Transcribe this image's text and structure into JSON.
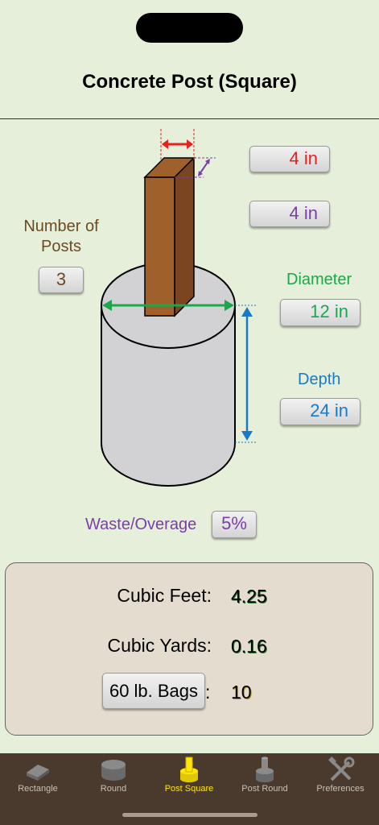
{
  "title": "Concrete Post (Square)",
  "inputs": {
    "post_width": "4 in",
    "post_depth": "4 in",
    "num_posts_label": "Number of Posts",
    "num_posts": "3",
    "diameter_label": "Diameter",
    "diameter": "12 in",
    "depth_label": "Depth",
    "depth": "24 in",
    "waste_label": "Waste/Overage",
    "waste": "5%"
  },
  "results": {
    "cubic_feet_label": "Cubic Feet:",
    "cubic_feet": "4.25",
    "cubic_yards_label": "Cubic Yards:",
    "cubic_yards": "0.16",
    "bags_button": "60 lb. Bags",
    "bags_colon": ":",
    "bags": "10"
  },
  "tabs": [
    {
      "label": "Rectangle",
      "icon": "rectangle-slab-icon"
    },
    {
      "label": "Round",
      "icon": "round-slab-icon"
    },
    {
      "label": "Post Square",
      "icon": "post-square-icon"
    },
    {
      "label": "Post Round",
      "icon": "post-round-icon"
    },
    {
      "label": "Preferences",
      "icon": "tools-icon"
    }
  ],
  "colors": {
    "background": "#e6efd9",
    "width_red": "#e8201e",
    "depth_purple": "#7a3fa6",
    "diameter_green": "#1aa84a",
    "depth_blue": "#1a7ac8",
    "posts_brown": "#6e4a22",
    "post_wood": "#a0602c",
    "tab_active": "#ffe600",
    "tabbar": "#4a3a2d"
  }
}
